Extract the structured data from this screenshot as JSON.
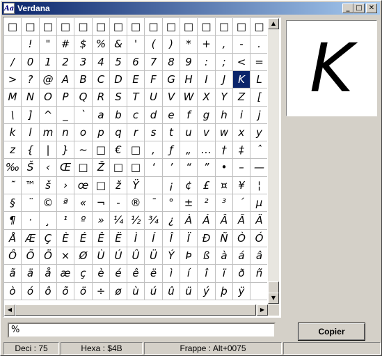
{
  "window": {
    "title": "Verdana",
    "icon_label": "Aa",
    "buttons": {
      "minimize": "_",
      "maximize": "□",
      "close": "✕"
    }
  },
  "char_grid": {
    "rows": [
      [
        "□",
        "□",
        "□",
        "□",
        "□",
        "□",
        "□",
        "□",
        "□",
        "□",
        "□",
        "□",
        "□",
        "□",
        "□"
      ],
      [
        "",
        "!",
        "\"",
        "#",
        "$",
        "%",
        "&",
        "'",
        "(",
        ")",
        "*",
        "+",
        ",",
        "-",
        "."
      ],
      [
        "/",
        "0",
        "1",
        "2",
        "3",
        "4",
        "5",
        "6",
        "7",
        "8",
        "9",
        ":",
        ";",
        "<",
        "="
      ],
      [
        ">",
        "?",
        "@",
        "A",
        "B",
        "C",
        "D",
        "E",
        "F",
        "G",
        "H",
        "I",
        "J",
        "K",
        "L"
      ],
      [
        "M",
        "N",
        "O",
        "P",
        "Q",
        "R",
        "S",
        "T",
        "U",
        "V",
        "W",
        "X",
        "Y",
        "Z",
        "["
      ],
      [
        "\\",
        "]",
        "^",
        "_",
        "`",
        "a",
        "b",
        "c",
        "d",
        "e",
        "f",
        "g",
        "h",
        "i",
        "j"
      ],
      [
        "k",
        "l",
        "m",
        "n",
        "o",
        "p",
        "q",
        "r",
        "s",
        "t",
        "u",
        "v",
        "w",
        "x",
        "y"
      ],
      [
        "z",
        "{",
        "|",
        "}",
        "~",
        "□",
        "€",
        "□",
        "‚",
        "ƒ",
        "„",
        "…",
        "†",
        "‡",
        "ˆ"
      ],
      [
        "‰",
        "Š",
        "‹",
        "Œ",
        "□",
        "Ž",
        "□",
        "□",
        "‘",
        "’",
        "“",
        "”",
        "•",
        "–",
        "—"
      ],
      [
        "˜",
        "™",
        "š",
        "›",
        "œ",
        "□",
        "ž",
        "Ÿ",
        "",
        "¡",
        "¢",
        "£",
        "¤",
        "¥",
        "¦"
      ],
      [
        "§",
        "¨",
        "©",
        "ª",
        "«",
        "¬",
        "-",
        "®",
        "¯",
        "°",
        "±",
        "²",
        "³",
        "´",
        "µ"
      ],
      [
        "¶",
        "·",
        "¸",
        "¹",
        "º",
        "»",
        "¼",
        "½",
        "¾",
        "¿",
        "À",
        "Á",
        "Â",
        "Ã",
        "Ä"
      ],
      [
        "Å",
        "Æ",
        "Ç",
        "È",
        "É",
        "Ê",
        "Ë",
        "Ì",
        "Í",
        "Î",
        "Ï",
        "Ð",
        "Ñ",
        "Ò",
        "Ó"
      ],
      [
        "Ô",
        "Õ",
        "Ö",
        "×",
        "Ø",
        "Ù",
        "Ú",
        "Û",
        "Ü",
        "Ý",
        "Þ",
        "ß",
        "à",
        "á",
        "â"
      ],
      [
        "ã",
        "ä",
        "å",
        "æ",
        "ç",
        "è",
        "é",
        "ê",
        "ë",
        "ì",
        "í",
        "î",
        "ï",
        "ð",
        "ñ"
      ],
      [
        "ò",
        "ó",
        "ô",
        "õ",
        "ö",
        "÷",
        "ø",
        "ù",
        "ú",
        "û",
        "ü",
        "ý",
        "þ",
        "ÿ",
        ""
      ]
    ],
    "selected": {
      "row": 3,
      "col": 13
    }
  },
  "preview": {
    "char": "K"
  },
  "input": {
    "value": "%"
  },
  "copy_button": {
    "label": "Copier"
  },
  "status": {
    "deci": "Deci : 75",
    "hexa": "Hexa : $4B",
    "frappe": "Frappe : Alt+0075"
  }
}
